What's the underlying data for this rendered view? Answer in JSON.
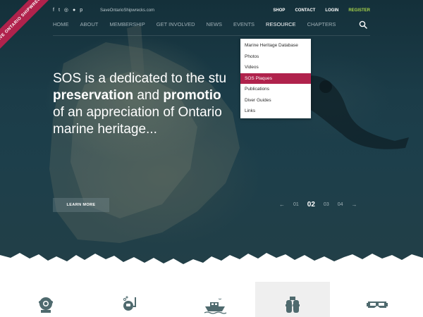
{
  "ribbon": {
    "text": "SAVE ONTARIO SHIPWRECKS"
  },
  "topbar": {
    "social": [
      {
        "name": "facebook-icon",
        "glyph": "f"
      },
      {
        "name": "twitter-icon",
        "glyph": "t"
      },
      {
        "name": "instagram-icon",
        "glyph": "◎"
      },
      {
        "name": "flickr-icon",
        "glyph": "●"
      },
      {
        "name": "pinterest-icon",
        "glyph": "p"
      }
    ],
    "site_url": "SaveOntarioShipwrecks.com",
    "links": {
      "shop": "SHOP",
      "contact": "CONTACT",
      "login": "LOGIN",
      "register": "REGISTER"
    }
  },
  "nav": {
    "items": [
      "HOME",
      "ABOUT",
      "MEMBERSHIP",
      "GET INVOLVED",
      "NEWS",
      "EVENTS",
      "RESOURCE",
      "CHAPTERS"
    ],
    "active": "RESOURCE"
  },
  "dropdown": {
    "items": [
      "Marine Heritage Database",
      "Photos",
      "Videos",
      "SOS Plaques",
      "Publications",
      "Diver Guides",
      "Links"
    ],
    "active": "SOS Plaques"
  },
  "hero": {
    "line1": "SOS is a dedicated to the stu",
    "line2_bold1": "preservation",
    "line2_mid": " and ",
    "line2_bold2": "promotio",
    "line3": "of an appreciation of Ontario",
    "line4": "marine heritage...",
    "button": "LEARN MORE"
  },
  "pager": {
    "prev": "←",
    "pages": [
      "01",
      "02",
      "03",
      "04"
    ],
    "current": "02",
    "next": "→"
  },
  "features": [
    "diver-helmet-icon",
    "snorkel-diver-icon",
    "boat-icon",
    "scuba-tank-icon",
    "dive-mask-icon"
  ],
  "colors": {
    "accent": "#b0224c",
    "register": "#a8d34a",
    "icon": "#4f6a6e",
    "hero_bg": "#1b3c48"
  }
}
